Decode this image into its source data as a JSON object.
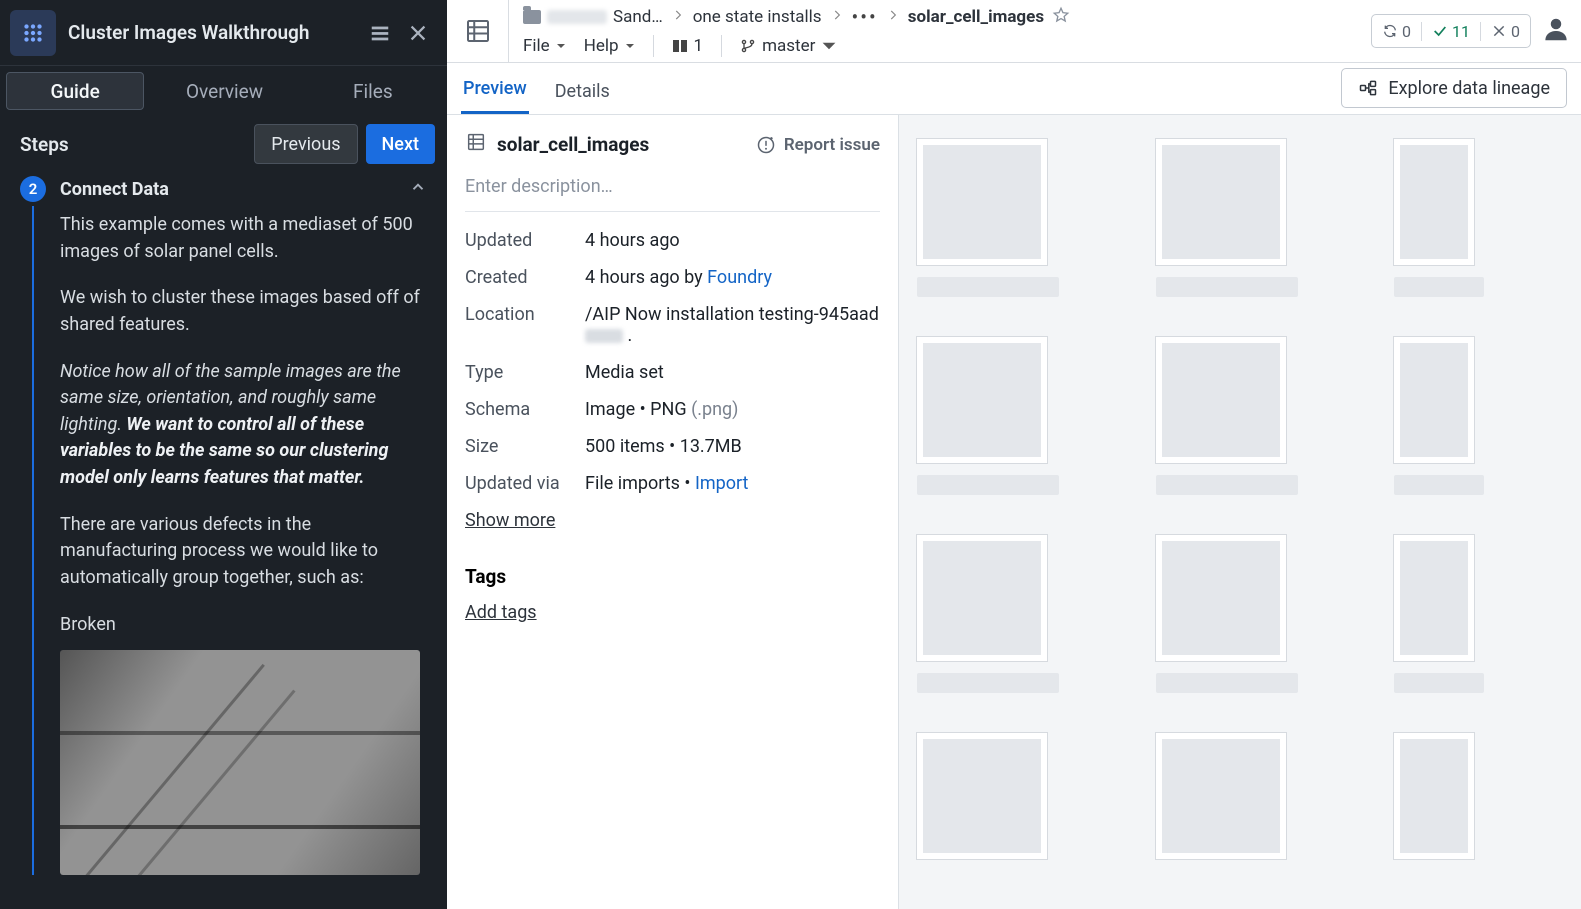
{
  "sidebar": {
    "title": "Cluster Images Walkthrough",
    "tabs": [
      "Guide",
      "Overview",
      "Files"
    ],
    "active_tab": 0,
    "steps_label": "Steps",
    "prev_label": "Previous",
    "next_label": "Next",
    "step_number": "2",
    "step_title": "Connect Data",
    "para1": "This example comes with a mediaset of 500 images of solar panel cells.",
    "para2": "We wish to cluster these images based off of shared features.",
    "para3_ital": "Notice how all of the sample images are the same size, orientation, and roughly same lighting. ",
    "para3_bold": "We want to control all of these variables to be the same so our clustering model only learns features that matter.",
    "para4": "There are various defects in the manufacturing process we would like to automatically group together, such as:",
    "defect_label": "Broken"
  },
  "topbar": {
    "crumbs": {
      "seg1_suffix": "Sand…",
      "seg2": "one state installs",
      "seg_final": "solar_cell_images"
    },
    "file_menu": "File",
    "help_menu": "Help",
    "col_count": "1",
    "branch": "master",
    "stats": {
      "sync": "0",
      "ok": "11",
      "fail": "0"
    }
  },
  "tabs": {
    "preview": "Preview",
    "details": "Details",
    "lineage": "Explore data lineage"
  },
  "meta": {
    "dataset_name": "solar_cell_images",
    "report_issue": "Report issue",
    "description_placeholder": "Enter description…",
    "rows": {
      "updated_k": "Updated",
      "updated_v": "4 hours ago",
      "created_k": "Created",
      "created_v_prefix": "4 hours ago by ",
      "created_v_link": "Foundry",
      "location_k": "Location",
      "location_v": "/AIP Now installation testing-945aad",
      "type_k": "Type",
      "type_v": "Media set",
      "schema_k": "Schema",
      "schema_v_main": "Image • PNG ",
      "schema_v_dim": "(.png)",
      "size_k": "Size",
      "size_v": "500 items  •  13.7MB",
      "updatedvia_k": "Updated via",
      "updatedvia_v_prefix": "File imports • ",
      "updatedvia_v_link": "Import"
    },
    "show_more": "Show more",
    "tags_header": "Tags",
    "add_tags": "Add tags"
  }
}
